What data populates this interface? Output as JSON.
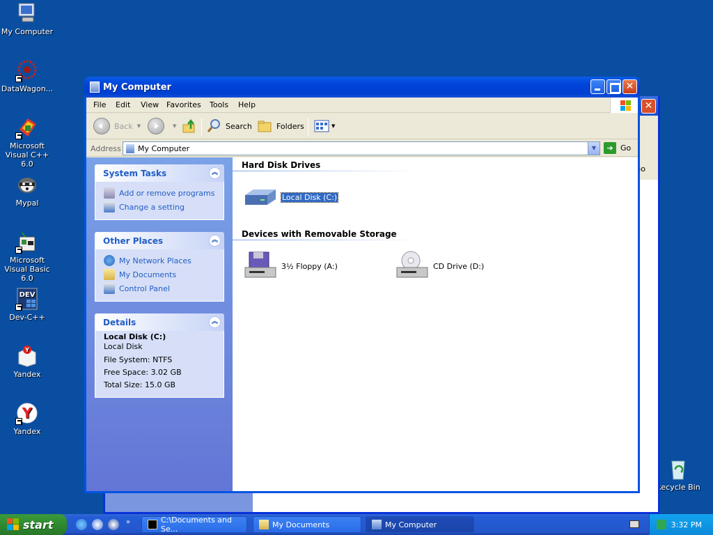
{
  "desktop": {
    "icons": [
      {
        "label": "My Computer",
        "icon": "my-computer-icon"
      },
      {
        "label": "DataWagon...",
        "icon": "datawagon-icon"
      },
      {
        "label": "Microsoft Visual C++ 6.0",
        "icon": "visual-cpp-icon"
      },
      {
        "label": "Mypal",
        "icon": "mypal-icon"
      },
      {
        "label": "Microsoft Visual Basic 6.0",
        "icon": "visual-basic-icon"
      },
      {
        "label": "Dev-C++",
        "icon": "dev-cpp-icon"
      },
      {
        "label": "Yandex",
        "icon": "yandex-box-icon"
      },
      {
        "label": "Yandex",
        "icon": "yandex-browser-icon"
      }
    ],
    "recycle_bin": "Recycle Bin",
    "bg_window_go": "Go"
  },
  "window": {
    "title": "My Computer",
    "menu": [
      "File",
      "Edit",
      "View",
      "Favorites",
      "Tools",
      "Help"
    ],
    "toolbar": {
      "back": "Back",
      "search": "Search",
      "folders": "Folders"
    },
    "address": {
      "label": "Address",
      "value": "My Computer",
      "go": "Go"
    }
  },
  "taskpane": {
    "system_tasks": {
      "title": "System Tasks",
      "items": [
        "Add or remove programs",
        "Change a setting"
      ]
    },
    "other_places": {
      "title": "Other Places",
      "items": [
        "My Network Places",
        "My Documents",
        "Control Panel"
      ]
    },
    "details": {
      "title": "Details",
      "name": "Local Disk (C:)",
      "type": "Local Disk",
      "file_system": "File System: NTFS",
      "free_space": "Free Space: 3.02 GB",
      "total_size": "Total Size: 15.0 GB"
    }
  },
  "files": {
    "hard_disk_title": "Hard Disk Drives",
    "local_disk": "Local Disk (C:)",
    "removable_title": "Devices with Removable Storage",
    "floppy": "3½ Floppy (A:)",
    "cd_drive": "CD Drive (D:)"
  },
  "taskbar": {
    "start": "start",
    "tasks": [
      "C:\\Documents and Se...",
      "My Documents",
      "My Computer"
    ],
    "clock": "3:32 PM"
  },
  "colors": {
    "desktop": "#0a4ea1",
    "title_bar": "#0054e3",
    "start": "#3c9a3c",
    "link": "#215dc6"
  }
}
